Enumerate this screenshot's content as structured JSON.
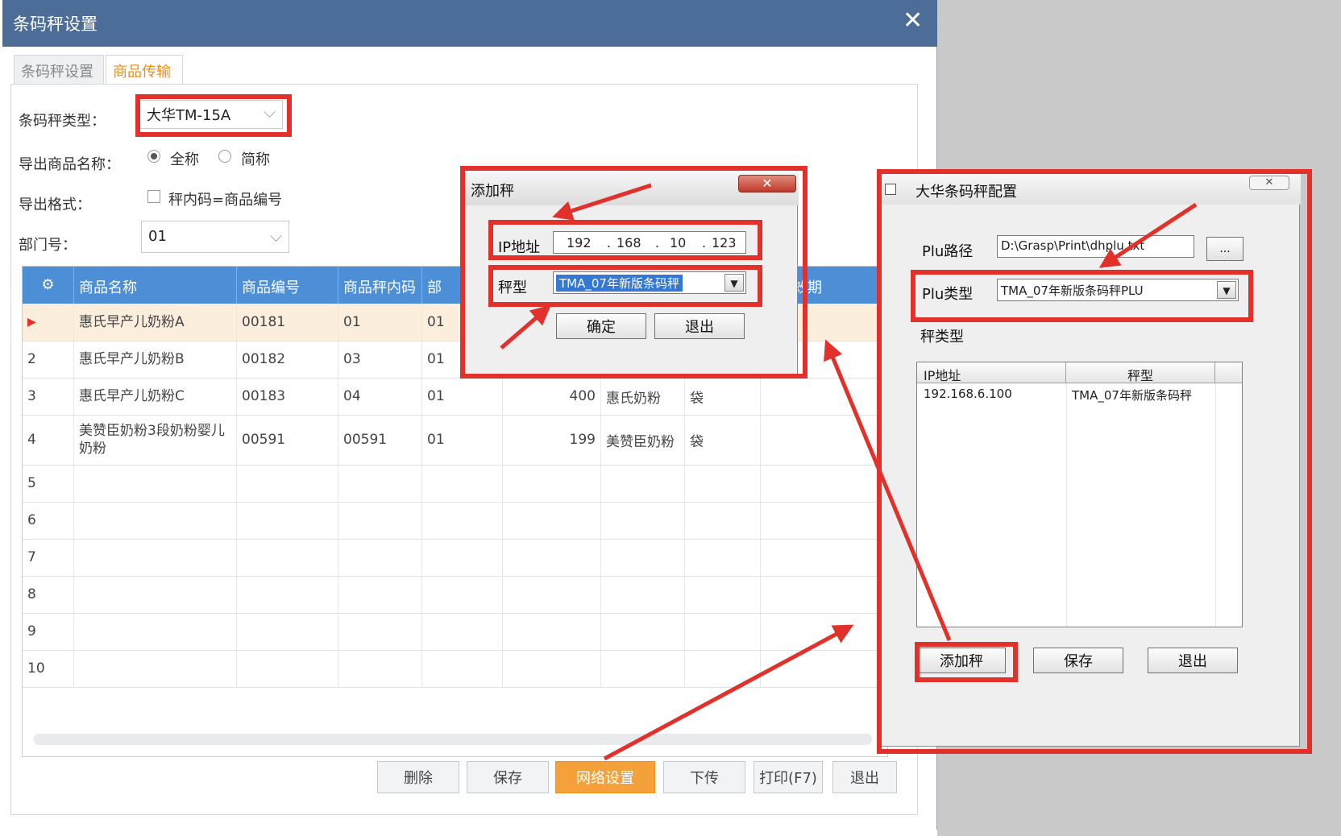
{
  "window": {
    "title": "条码秤设置",
    "close": "✕"
  },
  "tabs": [
    {
      "label": "条码秤设置"
    },
    {
      "label": "商品传输"
    }
  ],
  "form": {
    "scale_type_label": "条码秤类型：",
    "scale_type_value": "大华TM-15A",
    "export_name_label": "导出商品名称：",
    "option_full": "全称",
    "option_short": "简称",
    "export_format_label": "导出格式：",
    "format_checkbox": "秤内码=商品编号",
    "dept_label": "部门号：",
    "dept_value": "01"
  },
  "grid": {
    "columns": [
      "商品名称",
      "商品编号",
      "商品秤内码",
      "部",
      "效期"
    ],
    "rows": [
      {
        "no": "▶",
        "name": "惠氏早产儿奶粉A",
        "code": "00181",
        "inner": "01",
        "dept": "01",
        "price": "",
        "brand": "",
        "unit": ""
      },
      {
        "no": "2",
        "name": "惠氏早产儿奶粉B",
        "code": "00182",
        "inner": "03",
        "dept": "01",
        "price": "",
        "brand": "",
        "unit": ""
      },
      {
        "no": "3",
        "name": "惠氏早产儿奶粉C",
        "code": "00183",
        "inner": "04",
        "dept": "01",
        "price": "400",
        "brand": "惠氏奶粉",
        "unit": "袋"
      },
      {
        "no": "4",
        "name": "美赞臣奶粉3段奶粉婴儿奶粉",
        "code": "00591",
        "inner": "00591",
        "dept": "01",
        "price": "199",
        "brand": "美赞臣奶粉",
        "unit": "袋"
      },
      {
        "no": "5"
      },
      {
        "no": "6"
      },
      {
        "no": "7"
      },
      {
        "no": "8"
      },
      {
        "no": "9"
      },
      {
        "no": "10"
      }
    ]
  },
  "buttons": {
    "delete": "删除",
    "save": "保存",
    "network": "网络设置",
    "download": "下传",
    "print": "打印(F7)",
    "exit": "退出"
  },
  "add_dialog": {
    "title": "添加秤",
    "ip_label": "IP地址",
    "ip": [
      "192",
      "168",
      "10",
      "123"
    ],
    "type_label": "秤型",
    "type_value": "TMA_07年新版条码秤",
    "ok": "确定",
    "cancel": "退出",
    "close": "✕"
  },
  "cfg_dialog": {
    "title": "大华条码秤配置",
    "plu_path_label": "Plu路径",
    "plu_path_value": "D:\\Grasp\\Print\\dhplu.txt",
    "browse": "...",
    "plu_type_label": "Plu类型",
    "plu_type_value": "TMA_07年新版条码秤PLU",
    "scale_type_label": "秤类型",
    "list_headers": [
      "IP地址",
      "秤型"
    ],
    "list_rows": [
      {
        "ip": "192.168.6.100",
        "type": "TMA_07年新版条码秤"
      }
    ],
    "add": "添加秤",
    "save": "保存",
    "exit": "退出"
  },
  "colors": {
    "title_bar": "#4d6d99",
    "header": "#4d8fd6",
    "accent": "#f5a13a",
    "highlight": "#e2302a"
  }
}
